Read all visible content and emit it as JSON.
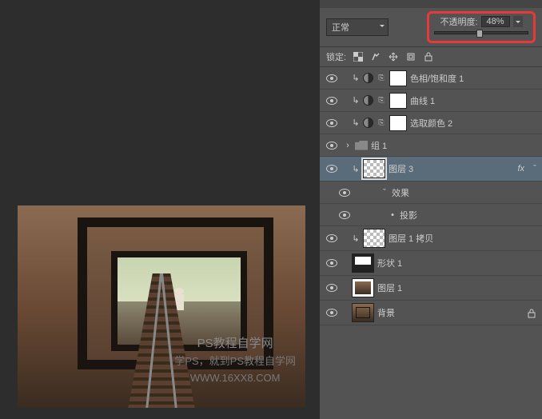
{
  "blend_mode": "正常",
  "opacity": {
    "label": "不透明度:",
    "value": "48%"
  },
  "lock": {
    "label": "锁定:"
  },
  "layers": [
    {
      "kind": "adj",
      "name": "色相/饱和度 1"
    },
    {
      "kind": "adj",
      "name": "曲线 1"
    },
    {
      "kind": "adj",
      "name": "选取颜色 2"
    },
    {
      "kind": "group",
      "name": "组 1",
      "expand": "›"
    },
    {
      "kind": "pixsel",
      "name": "图层 3",
      "fx": "fx",
      "expand": "ˇ"
    },
    {
      "kind": "fx",
      "name": "效果"
    },
    {
      "kind": "fx",
      "name": "投影"
    },
    {
      "kind": "smart",
      "name": "图层 1 拷贝"
    },
    {
      "kind": "shape",
      "name": "形状 1"
    },
    {
      "kind": "frame",
      "name": "图层 1"
    },
    {
      "kind": "frame",
      "name": "背景",
      "locked": true
    }
  ],
  "effects_expand": "ˇ",
  "watermark": {
    "line1": "PS教程自学网",
    "line2": "学PS，就到PS教程自学网",
    "line3": "WWW.16XX8.COM"
  }
}
